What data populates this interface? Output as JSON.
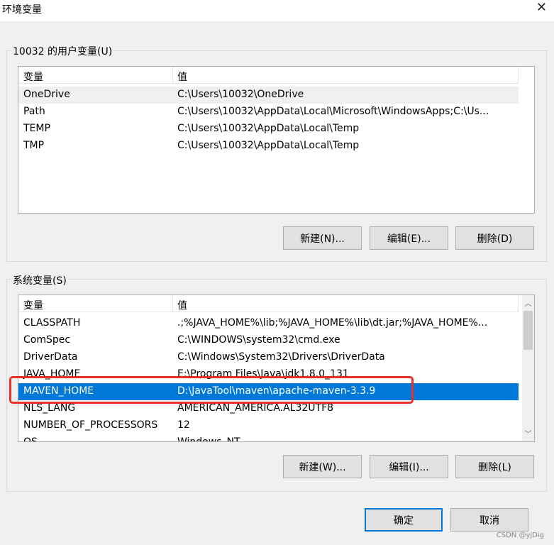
{
  "window": {
    "title": "环境变量",
    "close_glyph": "✕"
  },
  "user_group": {
    "label": "10032 的用户变量(U)",
    "columns": [
      "变量",
      "值"
    ],
    "rows": [
      {
        "name": "OneDrive",
        "value": "C:\\Users\\10032\\OneDrive"
      },
      {
        "name": "Path",
        "value": "C:\\Users\\10032\\AppData\\Local\\Microsoft\\WindowsApps;C:\\Us..."
      },
      {
        "name": "TEMP",
        "value": "C:\\Users\\10032\\AppData\\Local\\Temp"
      },
      {
        "name": "TMP",
        "value": "C:\\Users\\10032\\AppData\\Local\\Temp"
      }
    ],
    "buttons": {
      "new": "新建(N)...",
      "edit": "编辑(E)...",
      "delete": "删除(D)"
    }
  },
  "system_group": {
    "label": "系统变量(S)",
    "columns": [
      "变量",
      "值"
    ],
    "rows": [
      {
        "name": "CLASSPATH",
        "value": ".;%JAVA_HOME%\\lib;%JAVA_HOME%\\lib\\dt.jar;%JAVA_HOME%..."
      },
      {
        "name": "ComSpec",
        "value": "C:\\WINDOWS\\system32\\cmd.exe"
      },
      {
        "name": "DriverData",
        "value": "C:\\Windows\\System32\\Drivers\\DriverData"
      },
      {
        "name": "JAVA_HOME",
        "value": "E:\\Program Files\\Java\\jdk1.8.0_131"
      },
      {
        "name": "MAVEN_HOME",
        "value": "D:\\JavaTool\\maven\\apache-maven-3.3.9"
      },
      {
        "name": "NLS_LANG",
        "value": "AMERICAN_AMERICA.AL32UTF8"
      },
      {
        "name": "NUMBER_OF_PROCESSORS",
        "value": "12"
      },
      {
        "name": "OS",
        "value": "Windows_NT"
      }
    ],
    "selected_row": "MAVEN_HOME",
    "buttons": {
      "new": "新建(W)...",
      "edit": "编辑(I)...",
      "delete": "删除(L)"
    }
  },
  "footer": {
    "ok": "确定",
    "cancel": "取消"
  },
  "watermark": "CSDN @yjDig",
  "colors": {
    "selection": "#0078d7",
    "highlight_annotation": "#e8302a"
  }
}
